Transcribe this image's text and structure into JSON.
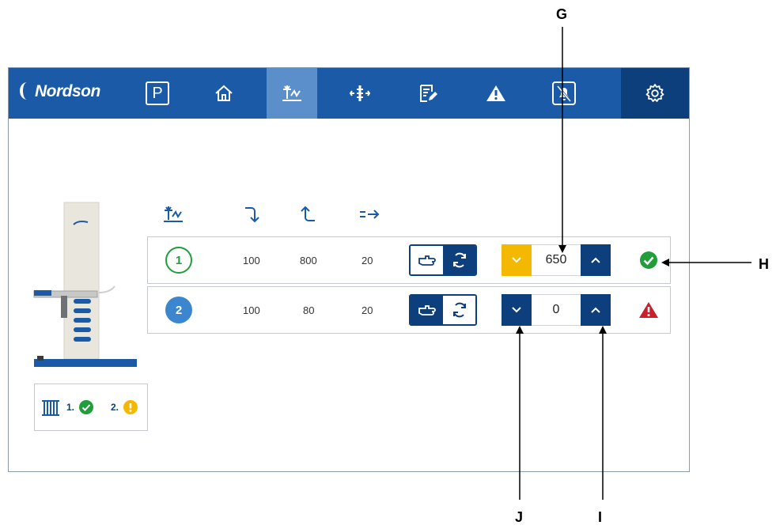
{
  "brand": {
    "logo_text": "Nordson"
  },
  "nav": [
    {
      "id": "park",
      "label": "P",
      "icon": "park-icon"
    },
    {
      "id": "home",
      "icon": "home-icon"
    },
    {
      "id": "positioner",
      "icon": "positioner-icon",
      "active": true
    },
    {
      "id": "axis",
      "icon": "axis-icon"
    },
    {
      "id": "recipe",
      "icon": "recipe-edit-icon"
    },
    {
      "id": "alarm",
      "icon": "warning-icon"
    },
    {
      "id": "mute",
      "icon": "alarm-mute-icon"
    },
    {
      "id": "settings",
      "icon": "gear-icon"
    }
  ],
  "columns": [
    {
      "icon": "positioner-icon"
    },
    {
      "icon": "down-arrow-icon"
    },
    {
      "icon": "up-arrow-icon"
    },
    {
      "icon": "speed-arrow-icon"
    }
  ],
  "rows": [
    {
      "number": "1",
      "style": "outline-green",
      "col1": "100",
      "col2": "800",
      "col3": "20",
      "position_value": "650",
      "down_state": "warning",
      "status": "ok"
    },
    {
      "number": "2",
      "style": "filled-blue",
      "col1": "100",
      "col2": "80",
      "col3": "20",
      "position_value": "0",
      "down_state": "normal",
      "status": "alarm"
    }
  ],
  "panel": {
    "item1_label": "1.",
    "item1_status": "ok",
    "item2_label": "2.",
    "item2_status": "warning"
  },
  "callouts": {
    "g": "G",
    "h": "H",
    "i": "I",
    "j": "J"
  },
  "colors": {
    "nav_bg": "#1a5aa6",
    "nav_active": "#5a8fcc",
    "nav_dark": "#0d3f7c",
    "button_blue": "#0d3f7c",
    "warning_yellow": "#f5b800",
    "ok_green": "#1f9e3a",
    "alarm_red": "#cc1f2c"
  }
}
